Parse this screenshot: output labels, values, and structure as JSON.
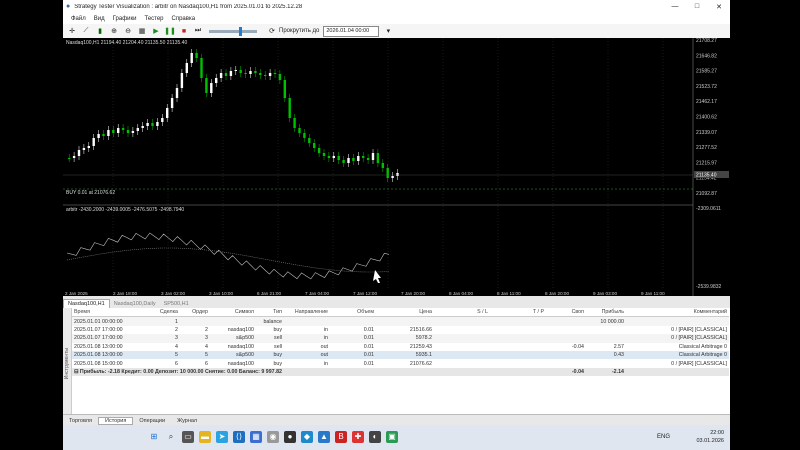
{
  "window": {
    "title": "Strategy Tester Visualization : arbitr on Nasdaq100,H1 from 2025.01.01 to 2025.12.28",
    "controls": [
      "—",
      "□",
      "✕"
    ]
  },
  "menu": [
    "Файл",
    "Вид",
    "Графики",
    "Тестер",
    "Справка"
  ],
  "toolbar": {
    "skip_label": "Прокрутить до",
    "date_value": "2026.01.04 00:00"
  },
  "chart": {
    "symbol_label": "Nasdaq100,H1  21194.40 21204.40 21135.50 21135.40",
    "order_label": "BUY 0.01 at 21076.62",
    "indicator_label": "arbitr -2430.2000 -2439.0005 -2476.5075 -2498.7940",
    "price_ticks": [
      "21708.27",
      "21646.82",
      "21585.27",
      "21523.72",
      "21462.17",
      "21400.62",
      "21339.07",
      "21277.52",
      "21215.97",
      "21154.42",
      "21092.87"
    ],
    "current_price": "21135.40",
    "ind_ticks": [
      "-2309.0611",
      "-2539.9832"
    ],
    "time_ticks": [
      "2 Jan 2025",
      "2 Jan 18:00",
      "3 Jan 02:00",
      "3 Jan 10:00",
      "6 Jan 21:00",
      "7 Jan 04:00",
      "7 Jan 12:00",
      "7 Jan 20:00",
      "8 Jan 04:00",
      "8 Jan 11:00",
      "8 Jan 20:00",
      "9 Jan 03:00",
      "9 Jan 11:00"
    ],
    "colors": {
      "bg": "#000000",
      "bull": "#ffffff",
      "bear": "#00c000",
      "grid": "#333333",
      "indicator": "#c0c0c0"
    }
  },
  "chart_tabs": [
    "Nasdaq100,H1",
    "Nasdaq100,Daily",
    "SP500,H1"
  ],
  "table": {
    "headers": [
      "Время",
      "Сделка",
      "Ордер",
      "Символ",
      "Тип",
      "Направление",
      "Объем",
      "Цена",
      "S / L",
      "T / P",
      "Своп",
      "Прибыль",
      "Комментарий"
    ],
    "rows": [
      [
        "2025.01.01 00:00:00",
        "1",
        "",
        "",
        "balance",
        "",
        "",
        "",
        "",
        "",
        "",
        "10 000.00",
        ""
      ],
      [
        "2025.01.07 17:00:00",
        "2",
        "2",
        "nasdaq100",
        "buy",
        "in",
        "0.01",
        "21516.66",
        "",
        "",
        "",
        "",
        "0 / [PAIR] [CLASSICAL]"
      ],
      [
        "2025.01.07 17:00:00",
        "3",
        "3",
        "s&p500",
        "sell",
        "in",
        "0.01",
        "5978.2",
        "",
        "",
        "",
        "",
        "0 / [PAIR] [CLASSICAL]"
      ],
      [
        "2025.01.08 13:00:00",
        "4",
        "4",
        "nasdaq100",
        "sell",
        "out",
        "0.01",
        "21259.43",
        "",
        "",
        "-0.04",
        "2.57",
        "Classical Arbitrage 0"
      ],
      [
        "2025.01.08 13:00:00",
        "5",
        "5",
        "s&p500",
        "buy",
        "out",
        "0.01",
        "5935.1",
        "",
        "",
        "",
        "0.43",
        "Classical Arbitrage 0"
      ],
      [
        "2025.01.08 15:00:00",
        "6",
        "6",
        "nasdaq100",
        "buy",
        "in",
        "0.01",
        "21076.62",
        "",
        "",
        "",
        "",
        "0 / [PAIR] [CLASSICAL]"
      ]
    ],
    "summary": {
      "text": "Прибыль: -2.18  Кредит: 0.00  Депозит: 10 000.00  Снятие: 0.00  Баланс: 9 997.82",
      "swap": "-0.04",
      "profit": "-2.14"
    }
  },
  "side_label": "Инструменты",
  "bottom_tabs": [
    "Торговля",
    "История",
    "Операции",
    "Журнал"
  ],
  "taskbar": {
    "lang": "ENG",
    "time": "22:00",
    "date": "03.01.2026"
  }
}
